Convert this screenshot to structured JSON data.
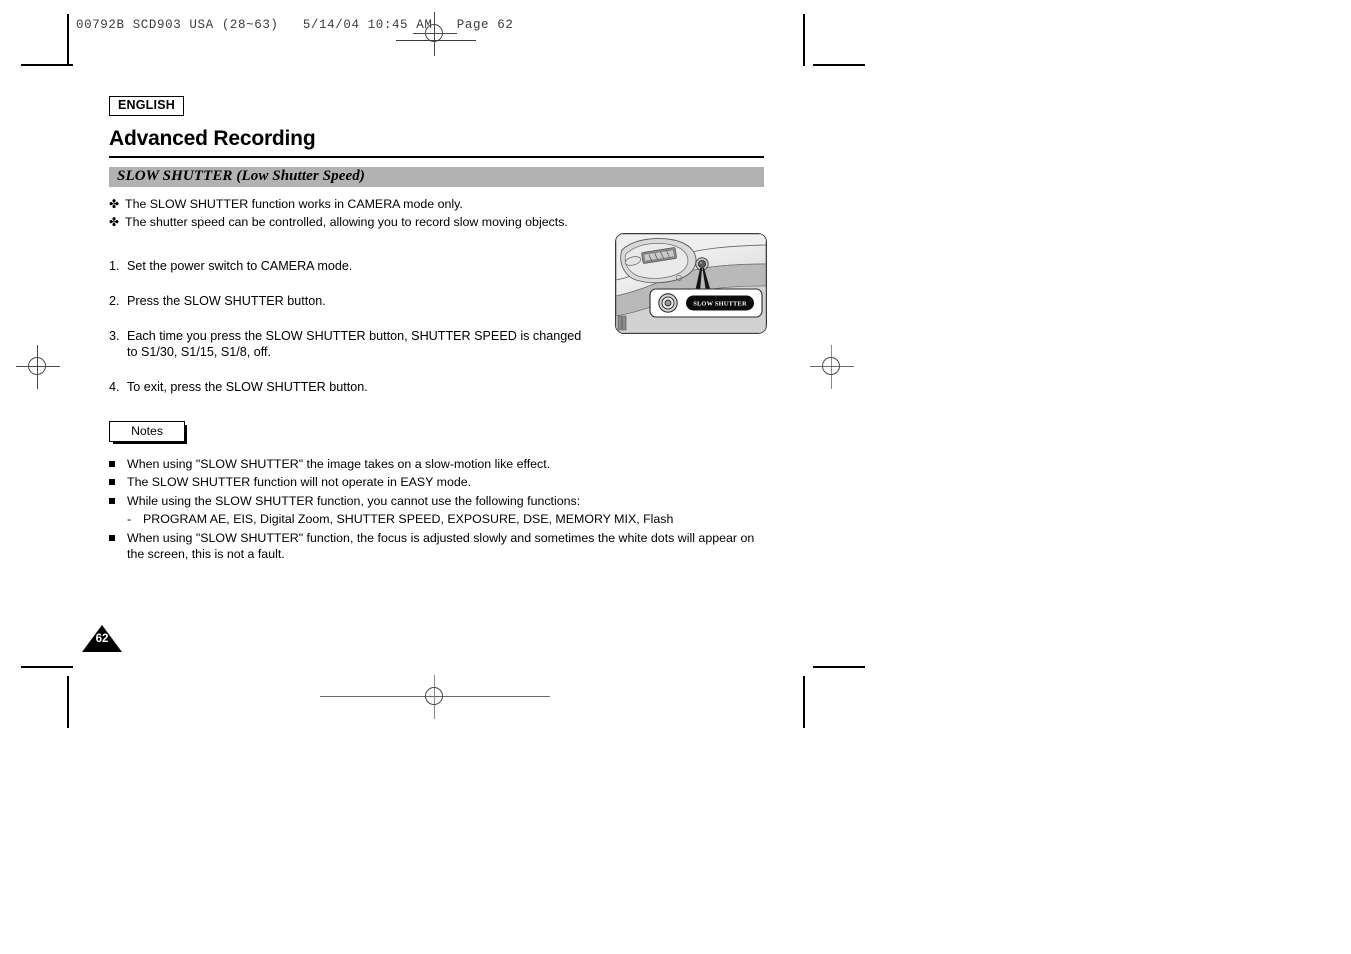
{
  "prepress": {
    "header_line": "00792B SCD903 USA (28~63)   5/14/04 10:45 AM   Page 62",
    "job_code": "00792B",
    "model": "SCD903",
    "region": "USA",
    "page_range": "(28~63)",
    "date": "5/14/04",
    "time": "10:45 AM",
    "page_label": "Page 62"
  },
  "document": {
    "language_badge": "ENGLISH",
    "chapter_title": "Advanced Recording",
    "section_title": "SLOW SHUTTER (Low Shutter Speed)",
    "page_number": "62"
  },
  "intro": {
    "bullet_glyph": "✤",
    "items": [
      "The SLOW SHUTTER function works in CAMERA mode only.",
      "The shutter speed can be controlled, allowing you to record slow moving objects."
    ]
  },
  "steps": [
    {
      "num": "1.",
      "text": "Set the power switch to CAMERA mode."
    },
    {
      "num": "2.",
      "text": "Press the SLOW SHUTTER button."
    },
    {
      "num": "3.",
      "text": "Each time you press the SLOW SHUTTER button, SHUTTER SPEED is changed to S1/30, S1/15, S1/8, off."
    },
    {
      "num": "4.",
      "text": "To exit, press the SLOW SHUTTER button."
    }
  ],
  "notes": {
    "label": "Notes",
    "items": [
      "When using \"SLOW SHUTTER\" the image takes on a slow-motion like effect.",
      "The SLOW SHUTTER function will not operate in EASY mode.",
      "While using the SLOW SHUTTER function, you cannot use the following functions:",
      "When using \"SLOW SHUTTER\" function, the focus is adjusted slowly and sometimes the white dots will appear on the screen, this is not a fault."
    ],
    "sub_dash": "-",
    "sub_item": "PROGRAM AE, EIS, Digital Zoom, SHUTTER SPEED, EXPOSURE, DSE, MEMORY MIX, Flash"
  },
  "illustration": {
    "callout_label": "SLOW SHUTTER",
    "alt": "Camcorder top panel showing the SLOW SHUTTER button"
  },
  "colors": {
    "section_band": "#b2b2b2",
    "rule": "#000000",
    "illustration_body": "#e8e8e8",
    "callout_pill": "#000000"
  }
}
